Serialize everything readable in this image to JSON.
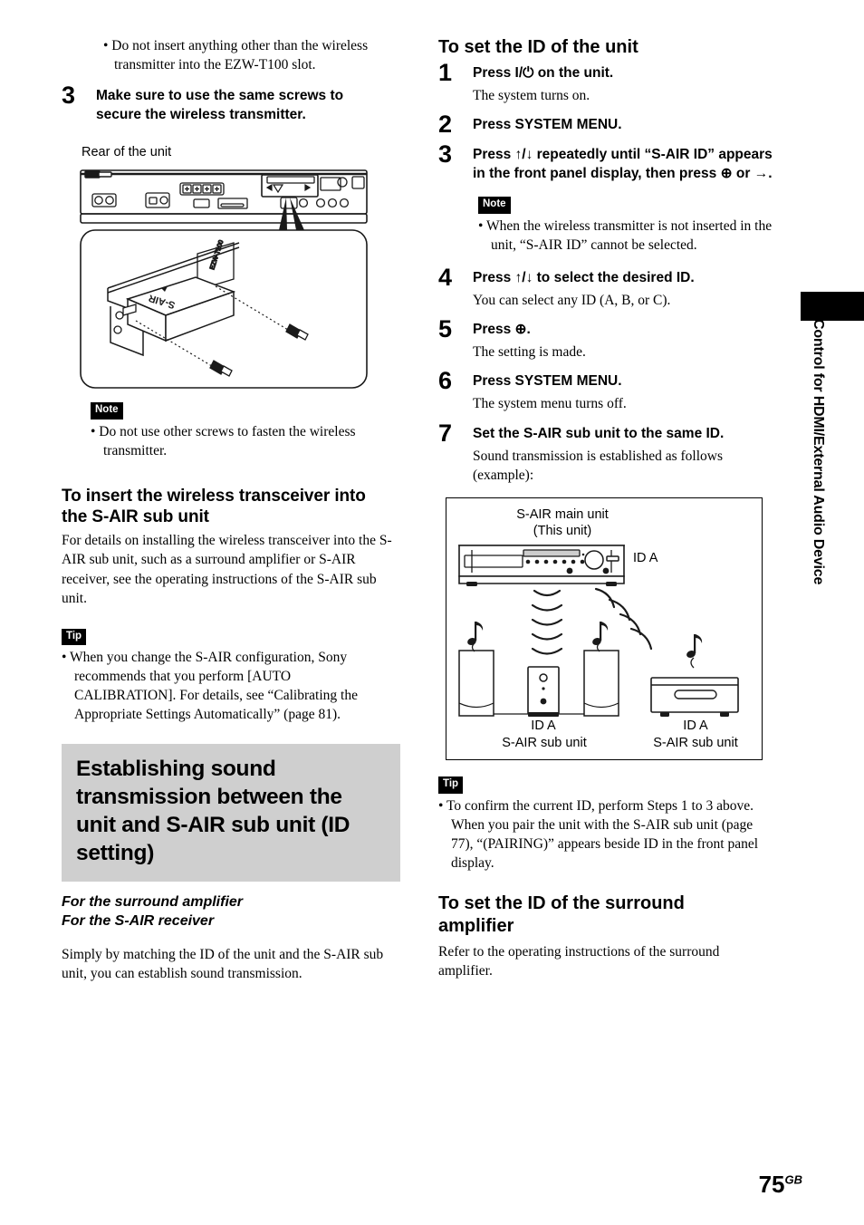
{
  "page": {
    "number": "75",
    "number_suffix": "GB",
    "side_tab_text": "Control for HDMI/External Audio Device"
  },
  "left_column": {
    "intro_bullet": "• Do not insert anything other than the wireless transmitter into the EZW-T100 slot.",
    "step3": {
      "number": "3",
      "title": "Make sure to use the same screws to secure the wireless transmitter."
    },
    "figure_rear": {
      "caption": "Rear of the unit",
      "module_label": "S-AIR",
      "slot_label": "EZW-T100"
    },
    "note_badge": "Note",
    "note_bullet": "• Do not use other screws to fasten the wireless transmitter.",
    "heading_insert": "To insert the wireless transceiver into the S-AIR sub unit",
    "body_insert": "For details on installing the wireless transceiver into the S-AIR sub unit, such as a surround amplifier or S-AIR receiver, see the operating instructions of the S-AIR sub unit.",
    "tip_badge": "Tip",
    "tip_bullet": "• When you change the S-AIR configuration, Sony recommends that you perform [AUTO CALIBRATION]. For details, see “Calibrating the Appropriate Settings Automatically” (page 81).",
    "banner_heading": "Establishing sound transmission between the unit and S-AIR sub unit (ID setting)",
    "sub_italic_1": "For the surround amplifier",
    "sub_italic_2": "For the S-AIR receiver",
    "body_simply": "Simply by matching the ID of the unit and the S-AIR sub unit, you can establish sound transmission."
  },
  "right_column": {
    "heading_set_id": "To set the ID of the unit",
    "steps": [
      {
        "number": "1",
        "title": "Press I/⏻ on the unit.",
        "desc": "The system turns on."
      },
      {
        "number": "2",
        "title": "Press SYSTEM MENU.",
        "desc": ""
      },
      {
        "number": "3",
        "title": "Press ↑/↓ repeatedly until “S-AIR ID” appears in the front panel display, then press ⊕ or →.",
        "desc": ""
      },
      {
        "number": "4",
        "title": "Press ↑/↓ to select the desired ID.",
        "desc": "You can select any ID (A, B, or C)."
      },
      {
        "number": "5",
        "title": "Press ⊕.",
        "desc": "The setting is made."
      },
      {
        "number": "6",
        "title": "Press SYSTEM MENU.",
        "desc": "The system menu turns off."
      },
      {
        "number": "7",
        "title": "Set the S-AIR sub unit to the same ID.",
        "desc": "Sound transmission is established as follows (example):"
      }
    ],
    "note_badge": "Note",
    "note_bullet": "• When the wireless transmitter is not inserted in the unit, “S-AIR ID” cannot be selected.",
    "diagram": {
      "main_unit_line1": "S-AIR main unit",
      "main_unit_line2": "(This unit)",
      "main_unit_id": "ID A",
      "sub_unit_center_id": "ID A",
      "sub_unit_center_label": "S-AIR sub unit",
      "sub_unit_right_id": "ID A",
      "sub_unit_right_label": "S-AIR sub unit"
    },
    "tip_badge": "Tip",
    "tip_bullet": "• To confirm the current ID, perform Steps 1 to 3 above. When you pair the unit with the S-AIR sub unit (page 77), “(PAIRING)” appears beside ID in the front panel display.",
    "heading_surround": "To set the ID of the surround amplifier",
    "body_surround": "Refer to the operating instructions of the surround amplifier."
  }
}
